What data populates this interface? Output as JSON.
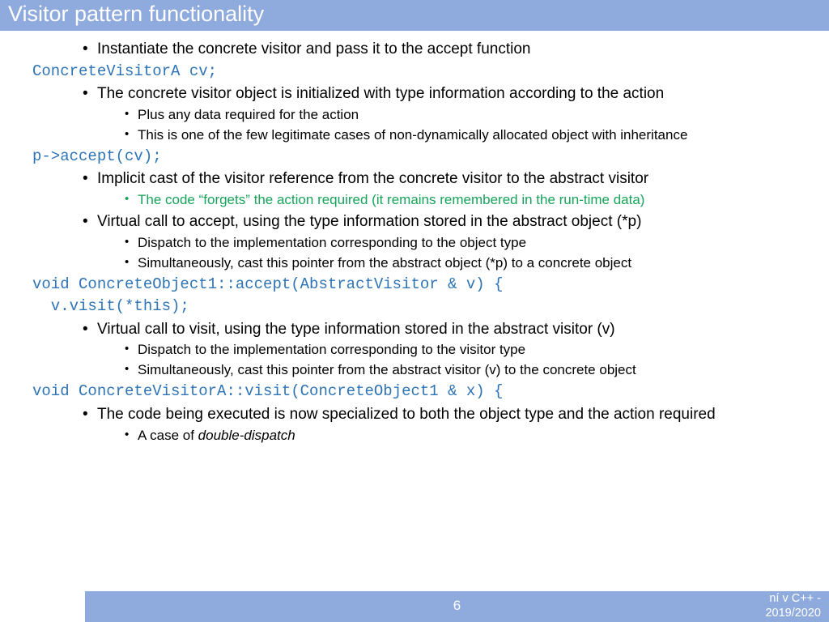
{
  "title": "Visitor pattern functionality",
  "lines": {
    "b1": "Instantiate the concrete visitor and pass it to the accept function",
    "c1": "ConcreteVisitorA cv;",
    "b2": "The concrete visitor object is initialized with type information according to the action",
    "b2a": "Plus any data required for the action",
    "b2b": "This is one of the few legitimate cases of non-dynamically allocated object with inheritance",
    "c2": "p->accept(cv);",
    "b3": "Implicit cast of the visitor reference from the concrete visitor to the abstract visitor",
    "b3a": "The code “forgets” the action required (it remains remembered in the run-time data)",
    "b4": "Virtual call to accept, using the type information stored in the abstract object (*p)",
    "b4a": "Dispatch to the implementation corresponding to the object type",
    "b4b": "Simultaneously, cast this pointer from the abstract object (*p) to a concrete object",
    "c3a": "void ConcreteObject1::accept(AbstractVisitor & v) {",
    "c3b": "  v.visit(*this);",
    "b5": "Virtual call to visit, using the type information stored in the abstract visitor (v)",
    "b5a": "Dispatch to the implementation corresponding to the visitor type",
    "b5b": "Simultaneously, cast this pointer from the abstract visitor (v) to the concrete object",
    "c4": "void ConcreteVisitorA::visit(ConcreteObject1 & x) {",
    "b6": "The code being executed is now specialized to both the object type and the action required",
    "b6a_prefix": "A case of ",
    "b6a_italic": "double-dispatch"
  },
  "footer": {
    "page": "6",
    "course_line1": "ní v C++ -",
    "course_line2": "2019/2020"
  }
}
